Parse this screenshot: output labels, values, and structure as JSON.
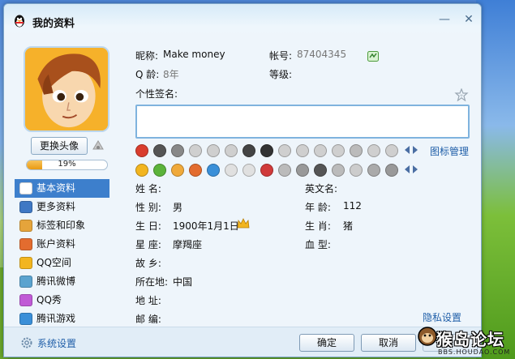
{
  "window": {
    "title": "我的资料",
    "minimize": "—",
    "close": "✕"
  },
  "profile": {
    "change_avatar": "更换头像",
    "progress_text": "19%",
    "progress_value": 19
  },
  "nav": {
    "items": [
      {
        "label": "基本资料",
        "icon": "id-card-icon",
        "color": "#ffffff"
      },
      {
        "label": "更多资料",
        "icon": "list-icon",
        "color": "#3f78c4"
      },
      {
        "label": "标签和印象",
        "icon": "tag-icon",
        "color": "#e5a43b"
      },
      {
        "label": "账户资料",
        "icon": "account-icon",
        "color": "#e36c2f"
      },
      {
        "label": "QQ空间",
        "icon": "star-icon",
        "color": "#f2b51f"
      },
      {
        "label": "腾讯微博",
        "icon": "weibo-icon",
        "color": "#5aa3cf"
      },
      {
        "label": "QQ秀",
        "icon": "qqshow-icon",
        "color": "#c05ad6"
      },
      {
        "label": "腾讯游戏",
        "icon": "game-icon",
        "color": "#3a8fd8"
      }
    ]
  },
  "info": {
    "nickname_label": "昵称:",
    "nickname": "Make money",
    "account_label": "帐号:",
    "account": "87404345",
    "age_label": "Q 龄:",
    "age": "8年",
    "level_label": "等级:",
    "signature_label": "个性签名:",
    "icon_manage": "图标管理"
  },
  "details": {
    "name_label": "姓    名:",
    "eng_name_label": "英文名:",
    "gender_label": "性    别:",
    "gender": "男",
    "years_label": "年    龄:",
    "years": "112",
    "birthday_label": "生    日:",
    "birthday": "1900年1月1日",
    "zodiac_label": "生    肖:",
    "zodiac": "猪",
    "constellation_label": "星    座:",
    "constellation": "摩羯座",
    "blood_label": "血    型:",
    "hometown_label": "故    乡:",
    "location_label": "所在地:",
    "location": "中国",
    "address_label": "地    址:",
    "postcode_label": "邮    编:",
    "privacy": "隐私设置"
  },
  "footer": {
    "settings": "系统设置",
    "ok": "确定",
    "cancel": "取消"
  },
  "watermark": {
    "text": "猴岛论坛",
    "sub": "BBS.HOUDAO.COM"
  },
  "colors": {
    "accent": "#3d7fcc",
    "link": "#1f5ea8",
    "signature_border": "#7fb3de"
  }
}
